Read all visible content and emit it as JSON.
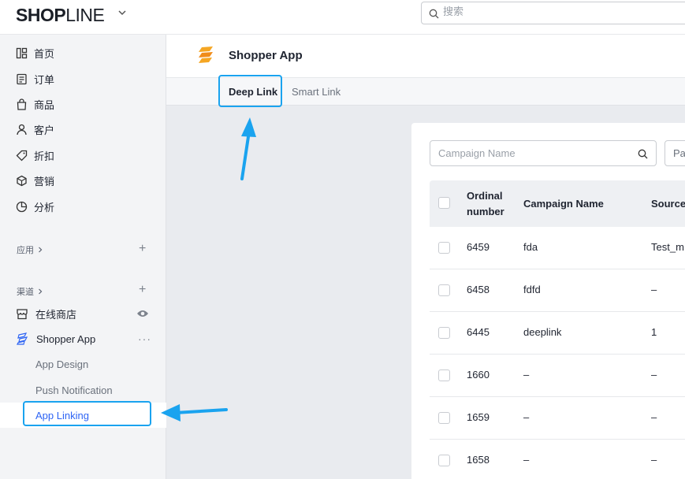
{
  "topbar": {
    "logo_bold": "SHOP",
    "logo_thin": "LINE",
    "search_placeholder": "搜索"
  },
  "sidebar": {
    "items": [
      {
        "label": "首页",
        "icon": "home-icon"
      },
      {
        "label": "订单",
        "icon": "orders-icon"
      },
      {
        "label": "商品",
        "icon": "products-icon"
      },
      {
        "label": "客户",
        "icon": "customers-icon"
      },
      {
        "label": "折扣",
        "icon": "discount-icon"
      },
      {
        "label": "营销",
        "icon": "marketing-icon"
      },
      {
        "label": "分析",
        "icon": "analytics-icon"
      }
    ],
    "apps_label": "应用",
    "channels_label": "渠道",
    "online_store": "在线商店",
    "shopper_app": "Shopper App",
    "sub_items": [
      "App Design",
      "Push Notification",
      "App Linking"
    ]
  },
  "header": {
    "title": "Shopper App"
  },
  "tabs": [
    "Deep Link",
    "Smart Link"
  ],
  "filters": {
    "campaign_placeholder": "Campaign Name",
    "second_filter_text": "Pa"
  },
  "table": {
    "headers": [
      "Ordinal number",
      "Campaign Name",
      "Source"
    ],
    "header_ordinal_line1": "Ordinal",
    "header_ordinal_line2": "number",
    "rows": [
      {
        "ordinal": "6459",
        "campaign": "fda",
        "source": "Test_m"
      },
      {
        "ordinal": "6458",
        "campaign": "fdfd",
        "source": "–"
      },
      {
        "ordinal": "6445",
        "campaign": "deeplink",
        "source": "1"
      },
      {
        "ordinal": "1660",
        "campaign": "–",
        "source": "–"
      },
      {
        "ordinal": "1659",
        "campaign": "–",
        "source": "–"
      },
      {
        "ordinal": "1658",
        "campaign": "–",
        "source": "–"
      }
    ]
  },
  "colors": {
    "accent_blue": "#2e64f4",
    "annotation_blue": "#1aa3ef",
    "app_icon_orange": "#f5a623"
  }
}
